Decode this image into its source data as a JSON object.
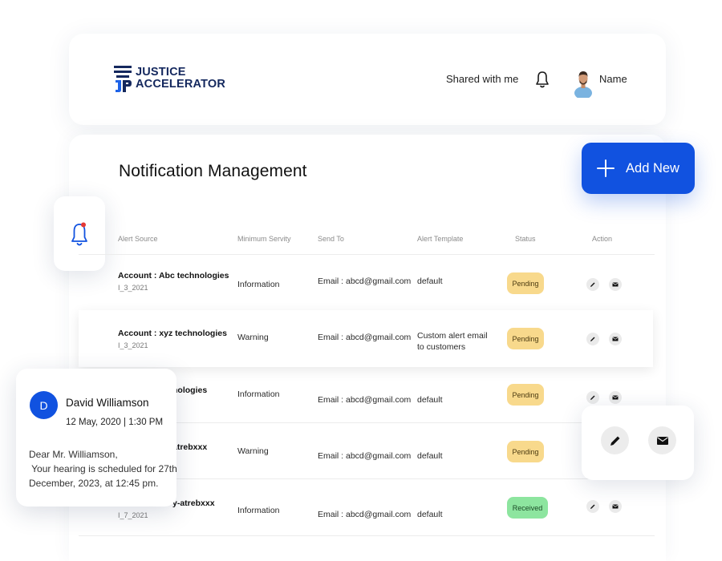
{
  "brand": {
    "line1": "JUSTICE",
    "line2": "ACCELERATOR",
    "color": "#14285e"
  },
  "header": {
    "shared_label": "Shared with me",
    "user_name": "Name"
  },
  "page": {
    "title": "Notification Management",
    "add_label": "Add New",
    "accent": "#1152e0"
  },
  "table": {
    "headers": [
      "Alert Source",
      "Minimum Servity",
      "Send To",
      "Alert Template",
      "Status",
      "Action"
    ],
    "rows": [
      {
        "source": "Account : Abc technologies",
        "date": "I_3_2021",
        "severity": "Information",
        "send_to": "Email : abcd@gmail.com",
        "template": "default",
        "status": "Pending"
      },
      {
        "source": "Account : xyz technologies",
        "date": "I_3_2021",
        "severity": "Warning",
        "send_to": "Email : abcd@gmail.com",
        "template_line1": "Custom alert email",
        "template_line2": "to customers",
        "status": "Pending"
      },
      {
        "source": "nologies",
        "severity": "Information",
        "send_to": "Email : abcd@gmail.com",
        "template": "default",
        "status": "Pending"
      },
      {
        "source": "atrebxxx",
        "severity": "Warning",
        "send_to": "Email : abcd@gmail.com",
        "template": "default",
        "status": "Pending"
      },
      {
        "source": "y-atrebxxx",
        "date": "I_7_2021",
        "severity": "Information",
        "send_to": "Email : abcd@gmail.com",
        "template": "default",
        "status": "Received"
      }
    ]
  },
  "notification": {
    "initial": "D",
    "name": "David Williamson",
    "date": "12 May, 2020 | 1:30 PM",
    "line1": "Dear Mr. Williamson,",
    "line2": " Your hearing is scheduled for 27th",
    "line3": "December, 2023, at 12:45 pm."
  },
  "colors": {
    "pending": "#f8d98c",
    "received": "#8de59f",
    "bell_dot": "#e53935"
  }
}
